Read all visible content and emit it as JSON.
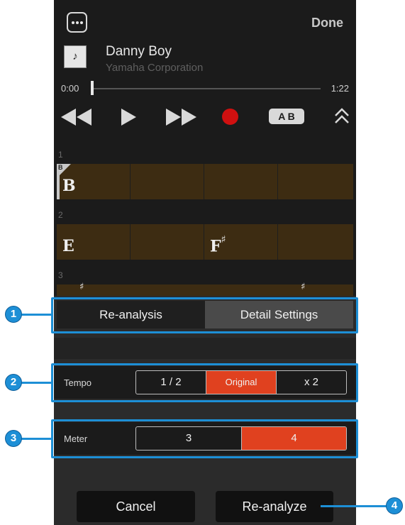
{
  "header": {
    "more_icon": "more-dots-icon",
    "done_label": "Done"
  },
  "song": {
    "title": "Danny Boy",
    "artist": "Yamaha Corporation",
    "art_icon": "music-note-icon",
    "art_glyph": "♪"
  },
  "playback": {
    "current_time": "0:00",
    "total_time": "1:22",
    "progress": 0.0
  },
  "controls": [
    "rewind-icon",
    "play-icon",
    "fast-forward-icon",
    "record-icon",
    "ab-repeat-icon",
    "collapse-chevron-icon"
  ],
  "ab_label": "A B",
  "bars": [
    {
      "number": "1",
      "chords": [
        "B",
        "",
        "",
        ""
      ],
      "section": "B"
    },
    {
      "number": "2",
      "chords": [
        "E",
        "",
        "F♯",
        ""
      ]
    },
    {
      "number": "3",
      "chords": [
        "♯",
        "",
        "",
        "♯"
      ]
    }
  ],
  "analysis_tabs": {
    "left": "Re-analysis",
    "right": "Detail Settings"
  },
  "tempo": {
    "label": "Tempo",
    "options": [
      "1 / 2",
      "Original",
      "x 2"
    ],
    "selected": 1
  },
  "meter": {
    "label": "Meter",
    "options": [
      "3",
      "4"
    ],
    "selected": 1
  },
  "actions": {
    "cancel": "Cancel",
    "reanalyze": "Re-analyze"
  },
  "callouts": [
    "1",
    "2",
    "3",
    "4"
  ],
  "colors": {
    "accent": "#e0411f",
    "callout": "#1d8fd6",
    "chord_bg": "#3d2c12",
    "record": "#d01010"
  }
}
